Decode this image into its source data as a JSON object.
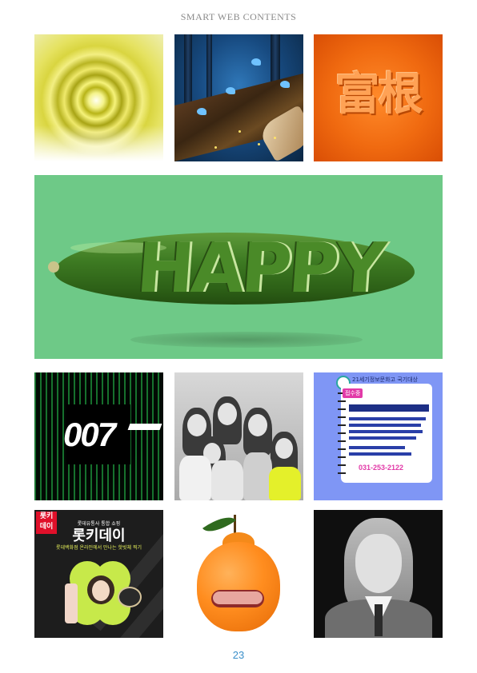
{
  "header": {
    "title": "SMART WEB CONTENTS"
  },
  "tiles": {
    "orange_chars": {
      "text": "富根"
    },
    "happy_banner": {
      "word": "HAPPY",
      "background": "#6ec987"
    },
    "bond": {
      "logo": "007"
    },
    "school_flyer": {
      "school": "21세기정보문화고 국기대상",
      "tag": "접수중",
      "phone": "031-253-2122"
    },
    "lotte": {
      "badge": "롯키\n데이",
      "subtitle": "롯데유통사 통합 쇼핑",
      "title": "롯키데이",
      "tagline": "롯데백화점 온라인에서 만나는 핫빗체 찍기"
    }
  },
  "footer": {
    "page_number": "23"
  }
}
